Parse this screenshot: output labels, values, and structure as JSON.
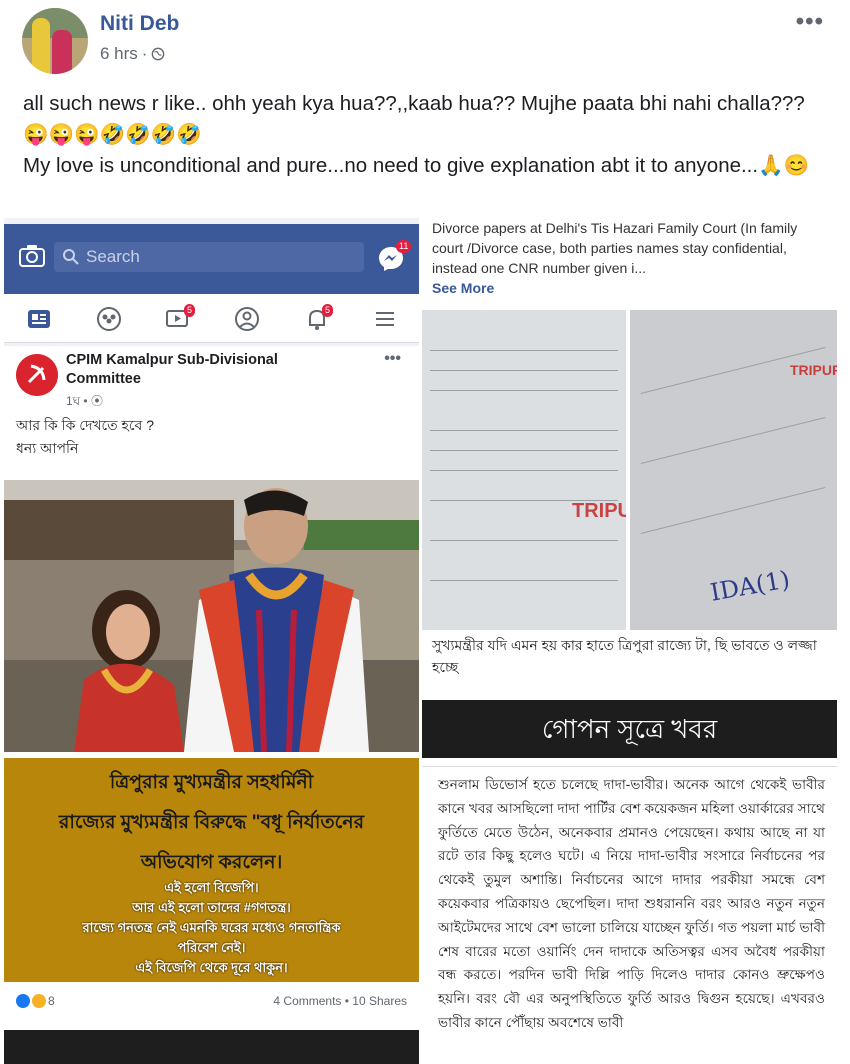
{
  "post": {
    "author": "Niti Deb",
    "time": "6 hrs",
    "more": "•••",
    "text_lines": [
      "all such news r like.. ohh yeah kya hua??,,kaab hua?? Mujhe paata bhi nahi challa???😜😜😜🤣🤣🤣🤣",
      "My love is unconditional and pure...no need to give explanation abt it to anyone...🙏😊"
    ]
  },
  "left_screenshot": {
    "search_placeholder": "Search",
    "messenger_badge": "11",
    "nav_badges": {
      "watch": "5",
      "notifications": "5"
    },
    "page_name": "CPIM Kamalpur Sub-Divisional Committee",
    "page_meta": "1ঘ • ⦿",
    "more": "•••",
    "text_lines": [
      "আর কি কি দেখতে হবে ?",
      "ধন্য আপনি"
    ],
    "banner_lines": [
      "ত্রিপুরার মুখ্যমন্ত্রীর সহধর্মিনী",
      "রাজ্যের মুখ্যমন্ত্রীর বিরুদ্ধে \"বধূ নির্যাতনের",
      "অভিযোগ করলেন।"
    ],
    "banner_small_lines": [
      "এই হলো বিজেপি।",
      "আর এই হলো তাদের #গণতন্ত্র।",
      "রাজ্যে গনতন্ত্র নেই এমনকি ঘরের মধ্যেও গনতান্ত্রিক",
      "পরিবেশ নেই।",
      "এই বিজেপি থেকে দূরে থাকুন।"
    ],
    "reaction_count": "8",
    "comments_shares": "4 Comments • 10 Shares"
  },
  "right_screenshot": {
    "caption": "Divorce papers at Delhi's Tis Hazari Family Court (In family court /Divorce case, both parties names stay confidential, instead one CNR number given i...",
    "see_more": "See More",
    "watermark": "TRIPURA",
    "handwriting": "IDA(1)",
    "sub_text": "সুখ্যমন্ত্রীর যদি এমন হয় কার হাতে ত্রিপুরা রাজ্যে টা, ছি ভাবতে ও লজ্জা হচ্ছে",
    "headline": "গোপন সূত্রে খবর",
    "news_body": "শুনলাম ডিভোর্স হতে চলেছে দাদা-ভাবীর। অনেক আগে থেকেই ভাবীর কানে খবর আসছিলো দাদা পার্টির বেশ কয়েকজন মহিলা ওয়ার্কারের সাথে ফুর্তিতে মেতে উঠেন, অনেকবার প্রমানও পেয়েছেন। কথায় আছে না যা রটে তার কিছু হলেও ঘটে। এ নিয়ে দাদা-ভাবীর সংসারে নির্বাচনের পর থেকেই তুমুল অশান্তি। নির্বাচনের আগে দাদার পরকীয়া সমন্ধে বেশ কয়েকবার পত্রিকায়ও ছেপেছিল। দাদা শুধরাননি বরং আরও নতুন নতুন আইটেমদের সাথে বেশ ভালো চালিয়ে যাচ্ছেন ফুর্তি। গত পয়লা মার্চ ভাবী শেষ বারের মতো ওয়ার্নিং দেন দাদাকে অতিসত্বর এসব অবৈধ পরকীয়া বন্ধ করতে। পরদিন ভাবী দিল্লি পাড়ি দিলেও দাদার কোনও ভ্রুক্ষেপও হয়নি। বরং বৌ এর অনুপস্থিতিতে ফুর্তি আরও দ্বিগুন হয়েছে। এখবরও ভাবীর কানে পৌঁছায় অবশেষে ভাবী"
  },
  "colors": {
    "author_blue": "#385898",
    "fb_blue": "#3b5998",
    "banner_gold": "#b8860b",
    "cpim_red": "#d9232d"
  }
}
